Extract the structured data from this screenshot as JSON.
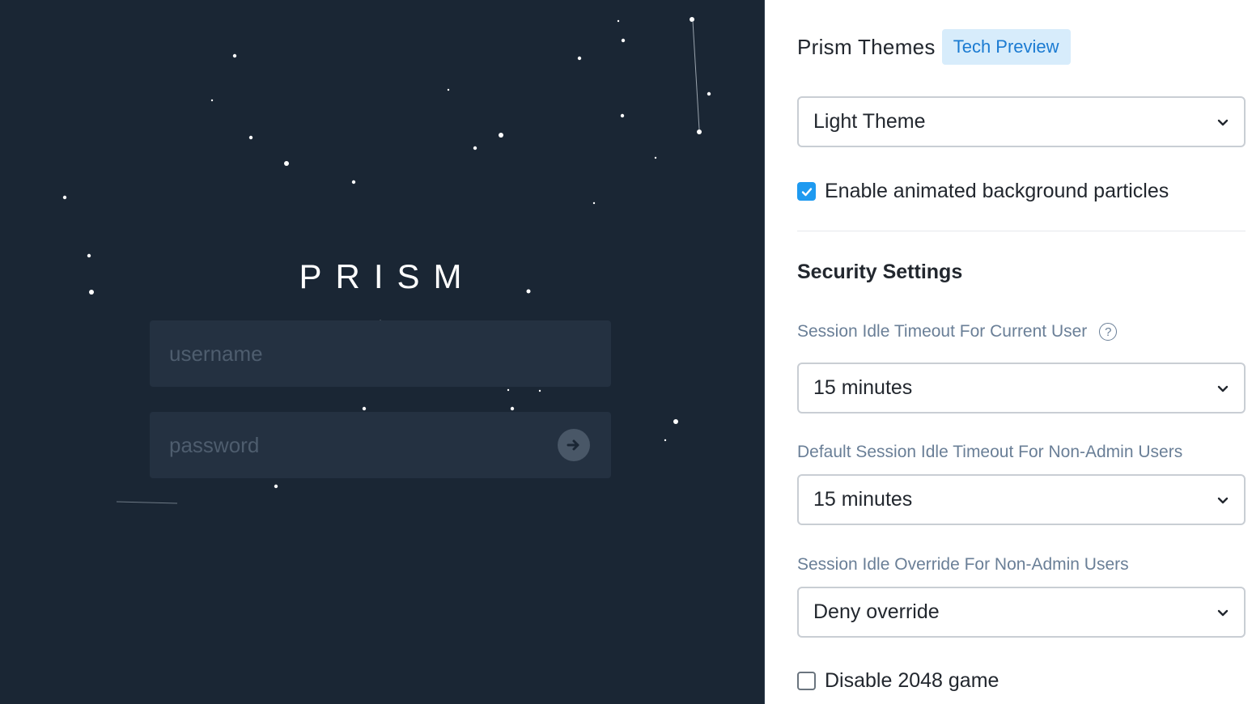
{
  "login_preview": {
    "logo": "PRISM",
    "username_placeholder": "username",
    "password_placeholder": "password",
    "submit_icon": "arrow-right-icon"
  },
  "themes": {
    "title": "Prism Themes",
    "badge": "Tech Preview",
    "selected_theme": "Light Theme",
    "particles_label": "Enable animated background particles",
    "particles_checked": true
  },
  "security": {
    "title": "Security Settings",
    "current_user_timeout": {
      "label": "Session Idle Timeout For Current User",
      "value": "15 minutes",
      "help_icon": "question-circle-icon"
    },
    "non_admin_timeout": {
      "label": "Default Session Idle Timeout For Non-Admin Users",
      "value": "15 minutes"
    },
    "non_admin_override": {
      "label": "Session Idle Override For Non-Admin Users",
      "value": "Deny override"
    },
    "disable_game_label": "Disable 2048 game",
    "disable_game_checked": false
  },
  "colors": {
    "preview_background": "#1a2634",
    "input_background": "#243141",
    "accent": "#1e9af0",
    "badge_background": "#d7ecfb",
    "badge_text": "#1b7bd2",
    "field_label": "#6a7f97"
  }
}
